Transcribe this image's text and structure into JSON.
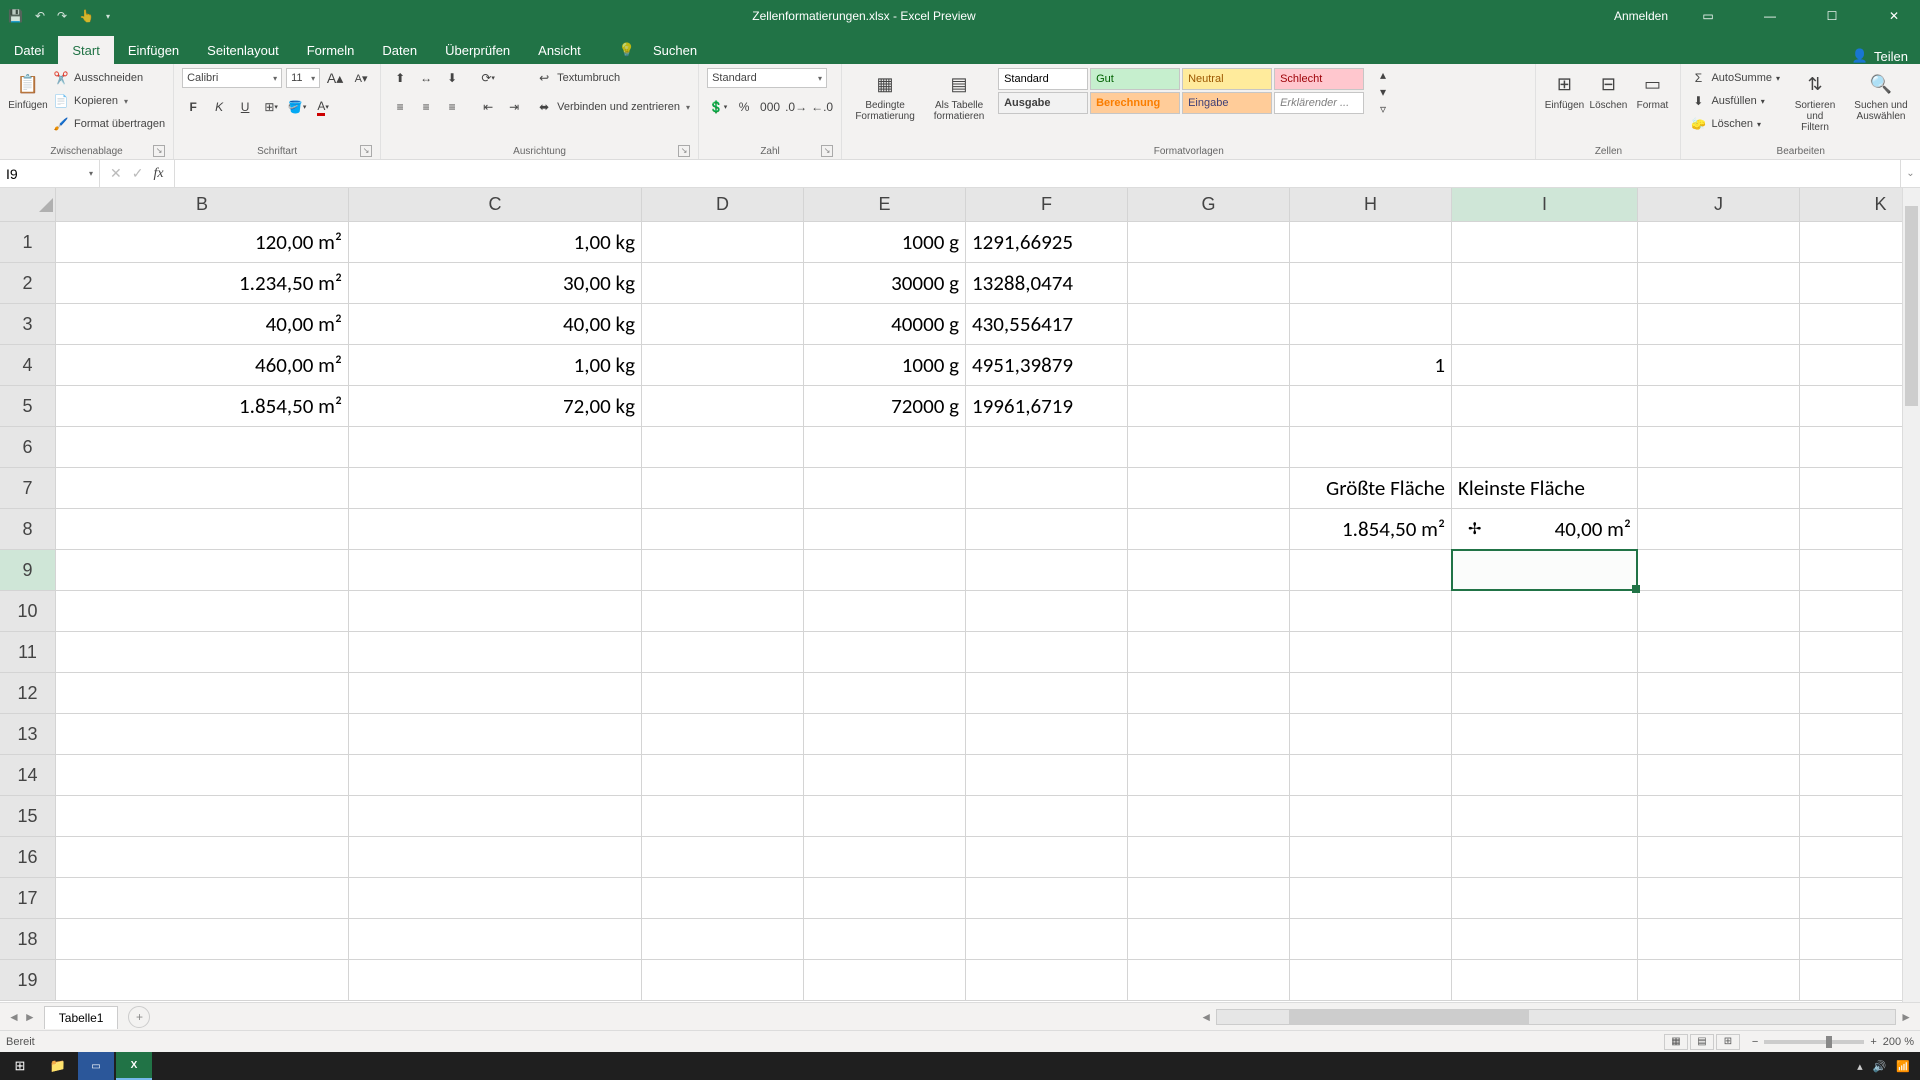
{
  "titlebar": {
    "title": "Zellenformatierungen.xlsx - Excel Preview",
    "sign_in": "Anmelden"
  },
  "tabs": {
    "items": [
      "Datei",
      "Start",
      "Einfügen",
      "Seitenlayout",
      "Formeln",
      "Daten",
      "Überprüfen",
      "Ansicht"
    ],
    "active": 1,
    "search": "Suchen",
    "share": "Teilen"
  },
  "ribbon": {
    "clipboard": {
      "paste": "Einfügen",
      "cut": "Ausschneiden",
      "copy": "Kopieren",
      "format_painter": "Format übertragen",
      "label": "Zwischenablage"
    },
    "font": {
      "name": "Calibri",
      "size": "11",
      "label": "Schriftart"
    },
    "alignment": {
      "wrap": "Textumbruch",
      "merge": "Verbinden und zentrieren",
      "label": "Ausrichtung"
    },
    "number": {
      "format": "Standard",
      "label": "Zahl"
    },
    "styles": {
      "cond": "Bedingte\nFormatierung",
      "table": "Als Tabelle\nformatieren",
      "items": [
        "Standard",
        "Gut",
        "Neutral",
        "Schlecht",
        "Ausgabe",
        "Berechnung",
        "Eingabe",
        "Erklärender ..."
      ],
      "label": "Formatvorlagen"
    },
    "cells": {
      "insert": "Einfügen",
      "delete": "Löschen",
      "format": "Format",
      "label": "Zellen"
    },
    "editing": {
      "autosum": "AutoSumme",
      "fill": "Ausfüllen",
      "clear": "Löschen",
      "sort": "Sortieren und\nFiltern",
      "find": "Suchen und\nAuswählen",
      "label": "Bearbeiten"
    }
  },
  "namebox": "I9",
  "formula": "",
  "columns": [
    "B",
    "C",
    "D",
    "E",
    "F",
    "G",
    "H",
    "I",
    "J",
    "K"
  ],
  "rows": [
    1,
    2,
    3,
    4,
    5,
    6,
    7,
    8,
    9,
    10,
    11,
    12,
    13,
    14,
    15,
    16,
    17,
    18,
    19
  ],
  "cells": {
    "B1": "120,00 m²",
    "C1": "1,00 kg",
    "E1": "1000  g",
    "F1": "1291,66925",
    "B2": "1.234,50 m²",
    "C2": "30,00 kg",
    "E2": "30000  g",
    "F2": "13288,0474",
    "B3": "40,00 m²",
    "C3": "40,00 kg",
    "E3": "40000  g",
    "F3": "430,556417",
    "B4": "460,00 m²",
    "C4": "1,00 kg",
    "E4": "1000  g",
    "F4": "4951,39879",
    "H4": "1",
    "B5": "1.854,50 m²",
    "C5": "72,00 kg",
    "E5": "72000  g",
    "F5": "19961,6719",
    "H7": "Größte Fläche",
    "I7": "Kleinste Fläche",
    "H8": "1.854,50 m²",
    "I8": "40,00 m²"
  },
  "left_align": [
    "I7",
    "F1",
    "F2",
    "F3",
    "F4",
    "F5"
  ],
  "selected_col": "I",
  "selected_row": 9,
  "sheet": {
    "tab": "Tabelle1"
  },
  "status": {
    "ready": "Bereit",
    "zoom": "200 %"
  }
}
